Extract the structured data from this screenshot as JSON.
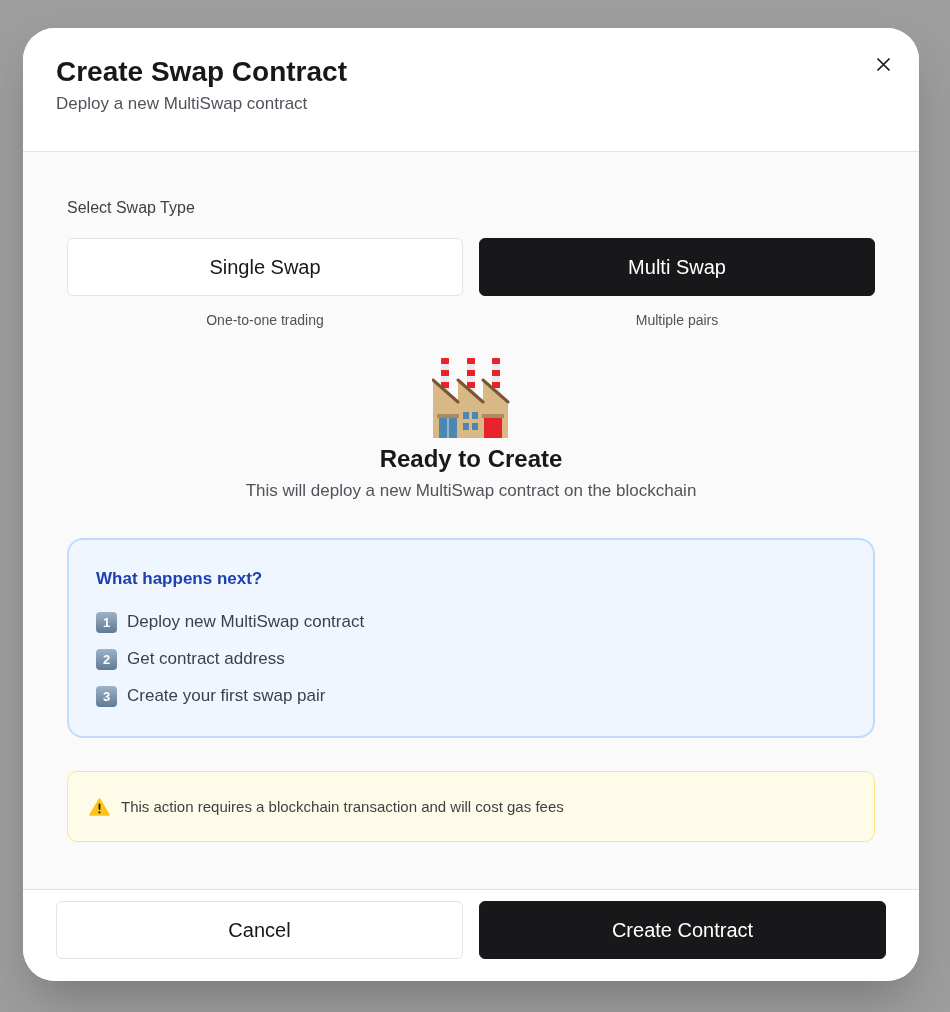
{
  "dialog": {
    "title": "Create Swap Contract",
    "subtitle": "Deploy a new MultiSwap contract"
  },
  "swap_type": {
    "label": "Select Swap Type",
    "options": [
      {
        "label": "Single Swap",
        "caption": "One-to-one trading",
        "selected": false
      },
      {
        "label": "Multi Swap",
        "caption": "Multiple pairs",
        "selected": true
      }
    ]
  },
  "summary": {
    "title": "Ready to Create",
    "description": "This will deploy a new MultiSwap contract on the blockchain"
  },
  "next_steps": {
    "title": "What happens next?",
    "steps": [
      {
        "number": "1",
        "text": "Deploy new MultiSwap contract"
      },
      {
        "number": "2",
        "text": "Get contract address"
      },
      {
        "number": "3",
        "text": "Create your first swap pair"
      }
    ]
  },
  "warning": {
    "text": "This action requires a blockchain transaction and will cost gas fees"
  },
  "buttons": [
    {
      "label": "Cancel",
      "kind": "secondary"
    },
    {
      "label": "Create Contract",
      "kind": "primary"
    }
  ]
}
